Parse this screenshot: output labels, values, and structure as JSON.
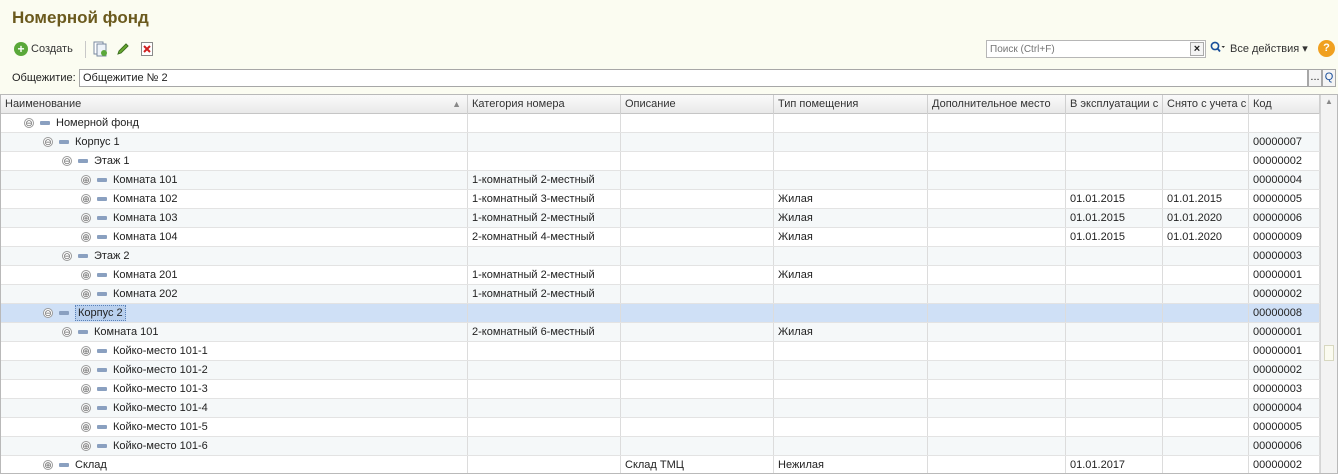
{
  "window": {
    "title": "Номерной фонд"
  },
  "toolbar": {
    "create_label": "Создать",
    "search_placeholder": "Поиск (Ctrl+F)",
    "search_clear": "×",
    "all_actions_label": "Все действия ▾",
    "help_label": "?"
  },
  "filter": {
    "label": "Общежитие:",
    "value": "Общежитие № 2",
    "dots": "...",
    "search": "Q"
  },
  "grid": {
    "columns": [
      "Наименование",
      "Категория номера",
      "Описание",
      "Тип помещения",
      "Дополнительное место",
      "В эксплуатации с",
      "Снято с учета с",
      "Код"
    ],
    "rows": [
      {
        "level": 0,
        "toggle": "⊖",
        "name": "Номерной фонд",
        "category": "",
        "description": "",
        "type": "",
        "extra": "",
        "from": "",
        "to": "",
        "code": ""
      },
      {
        "level": 1,
        "toggle": "⊖",
        "name": "Корпус 1",
        "category": "",
        "description": "",
        "type": "",
        "extra": "",
        "from": "",
        "to": "",
        "code": "00000007"
      },
      {
        "level": 2,
        "toggle": "⊖",
        "name": "Этаж 1",
        "category": "",
        "description": "",
        "type": "",
        "extra": "",
        "from": "",
        "to": "",
        "code": "00000002"
      },
      {
        "level": 3,
        "toggle": "⊕",
        "name": "Комната 101",
        "category": "1-комнатный 2-местный",
        "description": "",
        "type": "",
        "extra": "",
        "from": "",
        "to": "",
        "code": "00000004"
      },
      {
        "level": 3,
        "toggle": "⊕",
        "name": "Комната 102",
        "category": "1-комнатный 3-местный",
        "description": "",
        "type": "Жилая",
        "extra": "",
        "from": "01.01.2015",
        "to": "01.01.2015",
        "code": "00000005"
      },
      {
        "level": 3,
        "toggle": "⊕",
        "name": "Комната 103",
        "category": "1-комнатный 2-местный",
        "description": "",
        "type": "Жилая",
        "extra": "",
        "from": "01.01.2015",
        "to": "01.01.2020",
        "code": "00000006"
      },
      {
        "level": 3,
        "toggle": "⊕",
        "name": "Комната 104",
        "category": "2-комнатный 4-местный",
        "description": "",
        "type": "Жилая",
        "extra": "",
        "from": "01.01.2015",
        "to": "01.01.2020",
        "code": "00000009"
      },
      {
        "level": 2,
        "toggle": "⊖",
        "name": "Этаж 2",
        "category": "",
        "description": "",
        "type": "",
        "extra": "",
        "from": "",
        "to": "",
        "code": "00000003"
      },
      {
        "level": 3,
        "toggle": "⊕",
        "name": "Комната 201",
        "category": "1-комнатный 2-местный",
        "description": "",
        "type": "Жилая",
        "extra": "",
        "from": "",
        "to": "",
        "code": "00000001"
      },
      {
        "level": 3,
        "toggle": "⊕",
        "name": "Комната 202",
        "category": "1-комнатный 2-местный",
        "description": "",
        "type": "",
        "extra": "",
        "from": "",
        "to": "",
        "code": "00000002"
      },
      {
        "level": 1,
        "toggle": "⊖",
        "name": "Корпус 2",
        "category": "",
        "description": "",
        "type": "",
        "extra": "",
        "from": "",
        "to": "",
        "code": "00000008",
        "selected": true
      },
      {
        "level": 2,
        "toggle": "⊖",
        "name": "Комната 101",
        "category": "2-комнатный 6-местный",
        "description": "",
        "type": "Жилая",
        "extra": "",
        "from": "",
        "to": "",
        "code": "00000001"
      },
      {
        "level": 3,
        "toggle": "⊕",
        "name": "Койко-место 101-1",
        "category": "",
        "description": "",
        "type": "",
        "extra": "",
        "from": "",
        "to": "",
        "code": "00000001"
      },
      {
        "level": 3,
        "toggle": "⊕",
        "name": "Койко-место 101-2",
        "category": "",
        "description": "",
        "type": "",
        "extra": "",
        "from": "",
        "to": "",
        "code": "00000002"
      },
      {
        "level": 3,
        "toggle": "⊕",
        "name": "Койко-место 101-3",
        "category": "",
        "description": "",
        "type": "",
        "extra": "",
        "from": "",
        "to": "",
        "code": "00000003"
      },
      {
        "level": 3,
        "toggle": "⊕",
        "name": "Койко-место 101-4",
        "category": "",
        "description": "",
        "type": "",
        "extra": "",
        "from": "",
        "to": "",
        "code": "00000004"
      },
      {
        "level": 3,
        "toggle": "⊕",
        "name": "Койко-место 101-5",
        "category": "",
        "description": "",
        "type": "",
        "extra": "",
        "from": "",
        "to": "",
        "code": "00000005"
      },
      {
        "level": 3,
        "toggle": "⊕",
        "name": "Койко-место 101-6",
        "category": "",
        "description": "",
        "type": "",
        "extra": "",
        "from": "",
        "to": "",
        "code": "00000006"
      },
      {
        "level": 1,
        "toggle": "⊕",
        "name": "Склад",
        "category": "",
        "description": "Склад ТМЦ",
        "type": "Нежилая",
        "extra": "",
        "from": "01.01.2017",
        "to": "",
        "code": "00000002"
      }
    ]
  },
  "colors": {
    "title": "#6b5a1e",
    "selected_row": "#cfe0f6",
    "background": "#fbfcf1"
  },
  "icons": [
    "circle-plus-icon",
    "copy-icon",
    "edit-pencil-icon",
    "delete-icon",
    "search-icon",
    "help-icon",
    "folder-icon"
  ]
}
